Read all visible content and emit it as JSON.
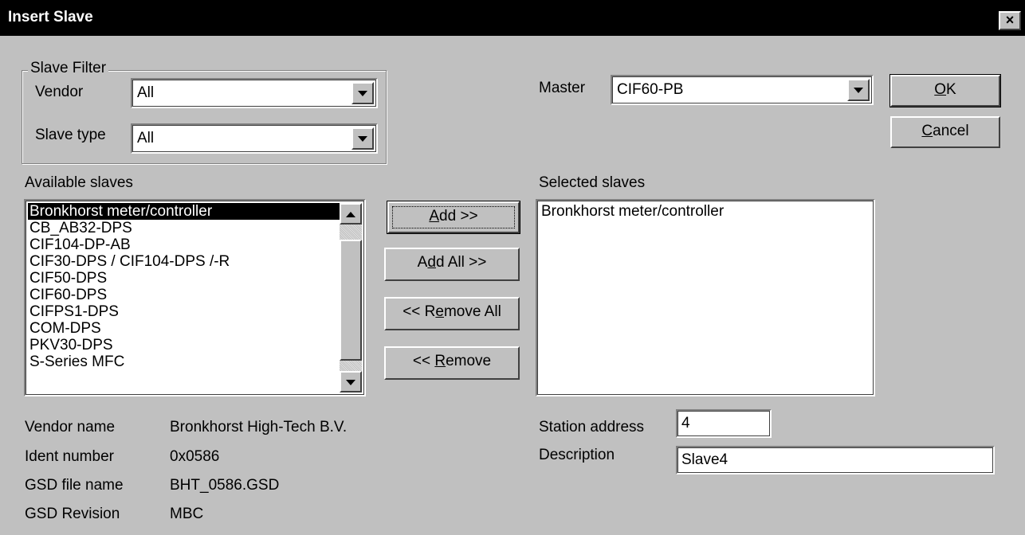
{
  "window": {
    "title": "Insert Slave",
    "close_glyph": "×"
  },
  "filter": {
    "group_label": "Slave Filter",
    "vendor_label": "Vendor",
    "vendor_value": "All",
    "slave_type_label": "Slave type",
    "slave_type_value": "All"
  },
  "master": {
    "label": "Master",
    "value": "CIF60-PB"
  },
  "buttons": {
    "ok_accel": "O",
    "ok_rest": "K",
    "cancel_accel": "C",
    "cancel_rest": "ancel",
    "add_accel": "A",
    "add_rest": "dd >>",
    "addall_pre": "A",
    "addall_accel": "d",
    "addall_rest": "d All >>",
    "removeall_pre": "<< R",
    "removeall_accel": "e",
    "removeall_rest": "move All",
    "remove_pre": "<< ",
    "remove_accel": "R",
    "remove_rest": "emove"
  },
  "available": {
    "label": "Available slaves",
    "items": [
      "Bronkhorst meter/controller",
      "CB_AB32-DPS",
      "CIF104-DP-AB",
      "CIF30-DPS / CIF104-DPS /-R",
      "CIF50-DPS",
      "CIF60-DPS",
      "CIFPS1-DPS",
      "COM-DPS",
      "PKV30-DPS",
      "S-Series MFC"
    ],
    "selected_index": 0
  },
  "selected": {
    "label": "Selected slaves",
    "items": [
      "Bronkhorst meter/controller"
    ]
  },
  "info": {
    "vendor_name_label": "Vendor name",
    "vendor_name_value": "Bronkhorst High-Tech B.V.",
    "ident_label": "Ident number",
    "ident_value": "0x0586",
    "gsd_file_label": "GSD file name",
    "gsd_file_value": "BHT_0586.GSD",
    "gsd_rev_label": "GSD Revision",
    "gsd_rev_value": "MBC"
  },
  "station": {
    "label": "Station address",
    "value": "4"
  },
  "description": {
    "label": "Description",
    "value": "Slave4"
  },
  "icons": {
    "dropdown": "chevron-down-icon",
    "scroll_up": "arrow-up-icon",
    "scroll_down": "arrow-down-icon",
    "close": "close-icon"
  }
}
